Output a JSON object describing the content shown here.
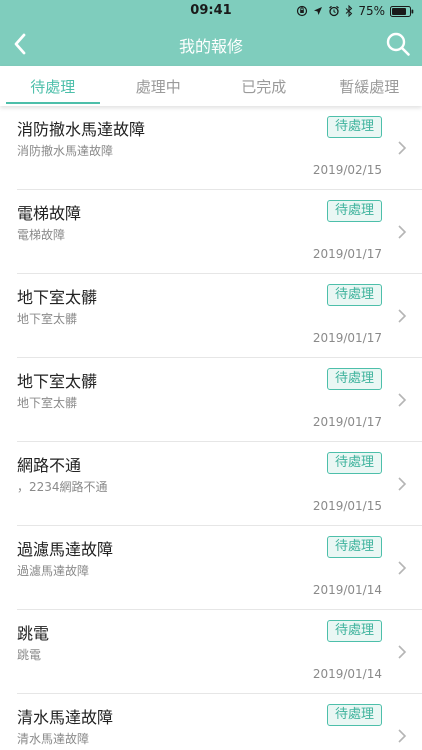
{
  "status_bar": {
    "time": "09:41",
    "battery": "75%",
    "icons": [
      "orientation-lock-icon",
      "location-icon",
      "alarm-icon",
      "bluetooth-icon",
      "battery-icon"
    ]
  },
  "nav": {
    "title": "我的報修",
    "back_icon": "back-arrow-icon",
    "search_icon": "search-icon"
  },
  "tabs": [
    {
      "label": "待處理",
      "active": true
    },
    {
      "label": "處理中",
      "active": false
    },
    {
      "label": "已完成",
      "active": false
    },
    {
      "label": "暫緩處理",
      "active": false
    }
  ],
  "items": [
    {
      "title": "消防撤水馬達故障",
      "desc": "消防撤水馬達故障",
      "badge": "待處理",
      "date": "2019/02/15"
    },
    {
      "title": "電梯故障",
      "desc": "電梯故障",
      "badge": "待處理",
      "date": "2019/01/17"
    },
    {
      "title": "地下室太髒",
      "desc": "地下室太髒",
      "badge": "待處理",
      "date": "2019/01/17"
    },
    {
      "title": "地下室太髒",
      "desc": "地下室太髒",
      "badge": "待處理",
      "date": "2019/01/17"
    },
    {
      "title": "網路不通",
      "desc": "，2234網路不通",
      "badge": "待處理",
      "date": "2019/01/15"
    },
    {
      "title": "過濾馬達故障",
      "desc": "過濾馬達故障",
      "badge": "待處理",
      "date": "2019/01/14"
    },
    {
      "title": "跳電",
      "desc": "跳電",
      "badge": "待處理",
      "date": "2019/01/14"
    },
    {
      "title": "清水馬達故障",
      "desc": "清水馬達故障",
      "badge": "待處理",
      "date": ""
    }
  ],
  "colors": {
    "header": "#7fcdbd",
    "accent": "#4dbfaa",
    "badge_bg": "#eaf7f4"
  }
}
